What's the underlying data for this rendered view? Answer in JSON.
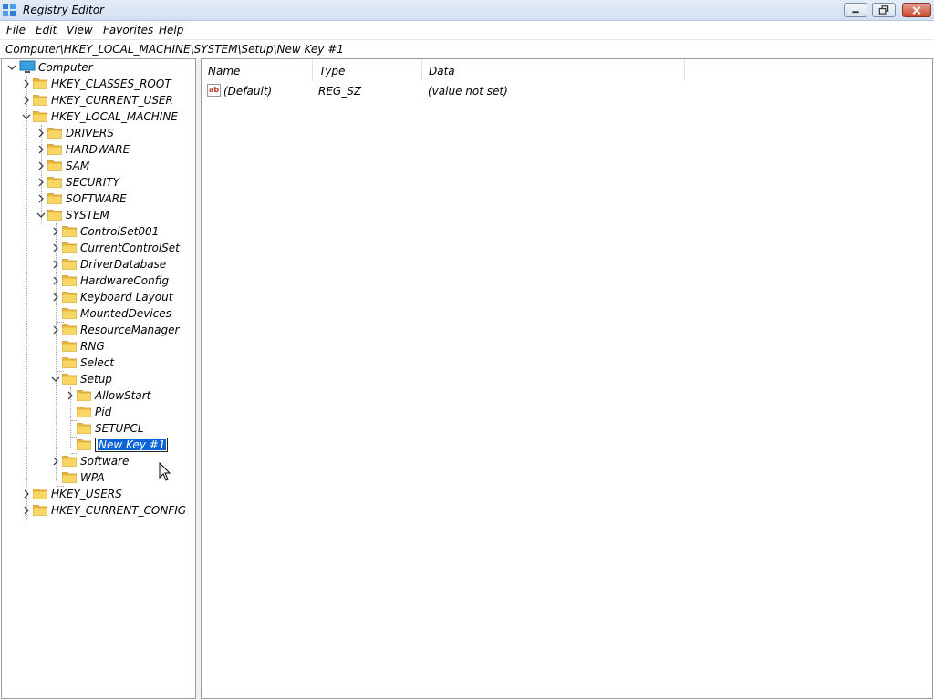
{
  "window": {
    "title": "Registry Editor",
    "icon": "regedit-icon",
    "controls": [
      "minimize",
      "restore",
      "close"
    ]
  },
  "menu": {
    "file": "File",
    "edit": "Edit",
    "view": "View",
    "favorites": "Favorites",
    "help": "Help"
  },
  "address": "Computer\\HKEY_LOCAL_MACHINE\\SYSTEM\\Setup\\New Key #1",
  "tree": {
    "computer": "Computer",
    "hkcr": "HKEY_CLASSES_ROOT",
    "hkcu": "HKEY_CURRENT_USER",
    "hklm": "HKEY_LOCAL_MACHINE",
    "drivers": "DRIVERS",
    "hardware": "HARDWARE",
    "sam": "SAM",
    "security": "SECURITY",
    "software": "SOFTWARE",
    "system": "SYSTEM",
    "controlset001": "ControlSet001",
    "currentcontrolset": "CurrentControlSet",
    "driverdatabase": "DriverDatabase",
    "hardwareconfig": "HardwareConfig",
    "keyboardlayout": "Keyboard Layout",
    "mounteddevices": "MountedDevices",
    "resourcemanager": "ResourceManager",
    "rng": "RNG",
    "select": "Select",
    "setup": "Setup",
    "allowstart": "AllowStart",
    "pid": "Pid",
    "setupcl": "SETUPCL",
    "newkey": "New Key #1",
    "software2": "Software",
    "wpa": "WPA",
    "hku": "HKEY_USERS",
    "hkcc": "HKEY_CURRENT_CONFIG"
  },
  "values": {
    "columns": {
      "name": "Name",
      "type": "Type",
      "data": "Data"
    },
    "rows": [
      {
        "icon": "string-value-icon",
        "name": "(Default)",
        "type": "REG_SZ",
        "data": "(value not set)"
      }
    ]
  },
  "colors": {
    "selection": "#0a64d8",
    "folder": "#f4c84e",
    "close_button": "#c94a32"
  }
}
